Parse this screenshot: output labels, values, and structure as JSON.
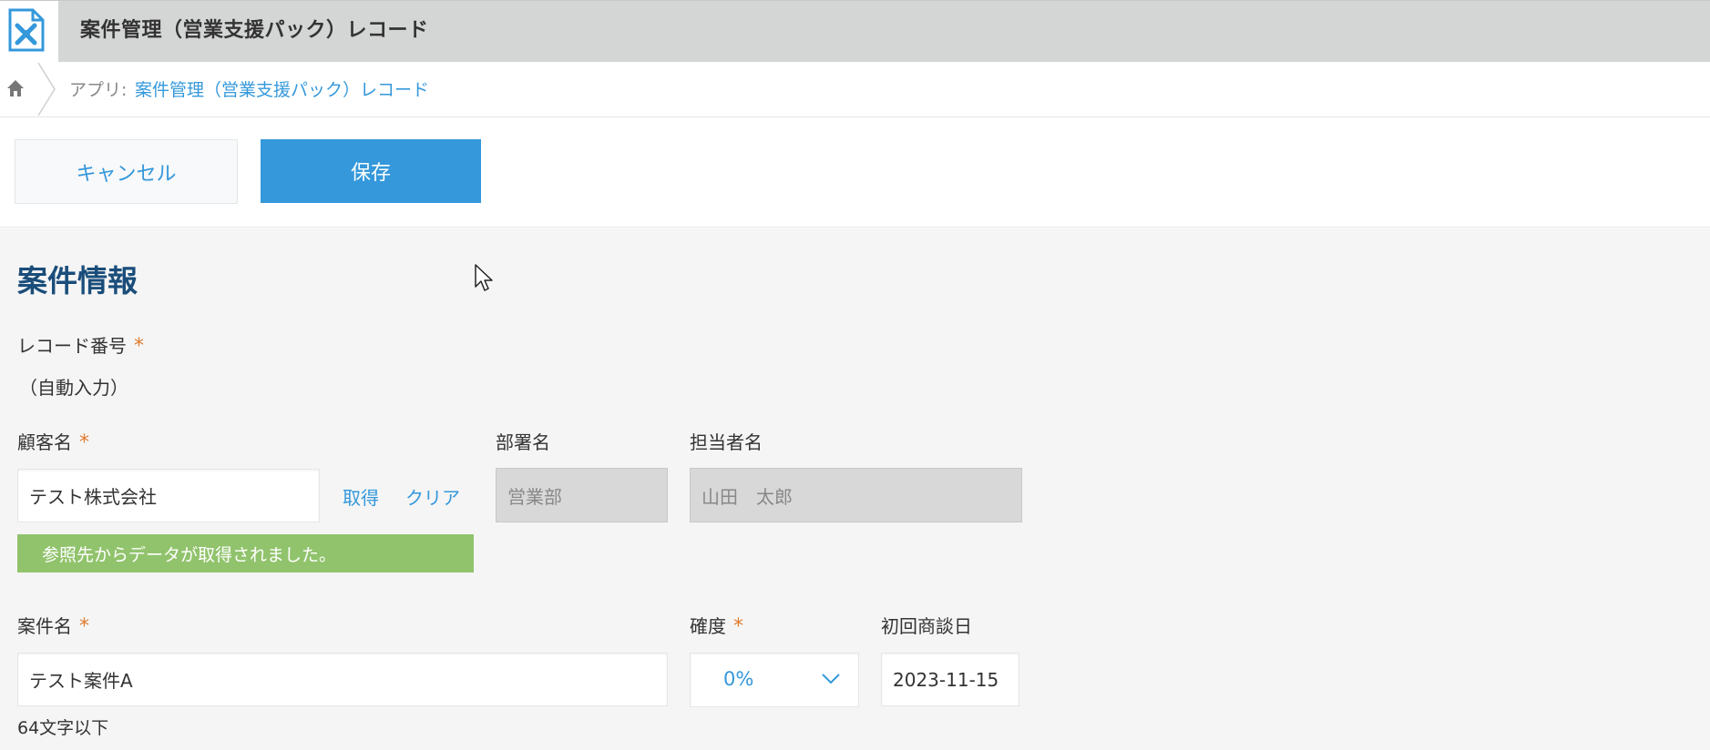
{
  "header": {
    "title": "案件管理（営業支援パック）レコード"
  },
  "breadcrumb": {
    "prefix": "アプリ:",
    "app_link": "案件管理（営業支援パック）レコード"
  },
  "toolbar": {
    "cancel_label": "キャンセル",
    "save_label": "保存"
  },
  "section": {
    "title": "案件情報"
  },
  "fields": {
    "record_number": {
      "label": "レコード番号",
      "required": "*",
      "value": "（自動入力）"
    },
    "customer_name": {
      "label": "顧客名",
      "required": "*",
      "value": "テスト株式会社",
      "fetch_label": "取得",
      "clear_label": "クリア"
    },
    "department": {
      "label": "部署名",
      "value": "営業部"
    },
    "person_in_charge": {
      "label": "担当者名",
      "value": "山田　太郎"
    },
    "lookup_notice": "参照先からデータが取得されました。",
    "project_name": {
      "label": "案件名",
      "required": "*",
      "value": "テスト案件A",
      "hint": "64文字以下"
    },
    "certainty": {
      "label": "確度",
      "required": "*",
      "value": "0%"
    },
    "first_meeting_date": {
      "label": "初回商談日",
      "value": "2023-11-15"
    }
  },
  "colors": {
    "accent": "#3498db",
    "section_title": "#1a4d7a",
    "required": "#e07b2e",
    "notice_bg": "#91c36c",
    "header_bg": "#d4d5d5"
  },
  "icons": [
    "app-icon",
    "home-icon",
    "chevron-down-icon",
    "mouse-cursor-icon"
  ]
}
